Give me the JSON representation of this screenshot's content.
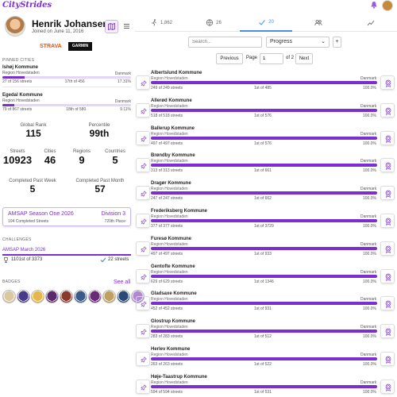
{
  "app": {
    "logo_text": "CityStrides"
  },
  "profile": {
    "name": "Henrik Johansen",
    "joined": "Joined on June 11, 2016",
    "integrations": [
      "STRAVA",
      "GARMIN"
    ]
  },
  "pinned": {
    "title": "PINNED CITIES",
    "cities": [
      {
        "name": "Ishøj Kommune",
        "region": "Region Hovedstaden",
        "country": "Danmark",
        "progress": 17.31,
        "streets": "27 of 156 streets",
        "rank": "17th of 456",
        "percent": "17.31%"
      },
      {
        "name": "Egedal Kommune",
        "region": "Region Hovedstaden",
        "country": "Danmark",
        "progress": 9.11,
        "streets": "79 of 867 streets",
        "rank": "18th of 580",
        "percent": "9.11%"
      }
    ]
  },
  "stats": {
    "global_rank_label": "Global Rank",
    "global_rank": "115",
    "percentile_label": "Percentile",
    "percentile": "99th",
    "streets_label": "Streets",
    "streets": "10923",
    "cities_label": "Cities",
    "cities": "46",
    "regions_label": "Regions",
    "regions": "9",
    "countries_label": "Countries",
    "countries": "5",
    "cpw_label": "Completed Past Week",
    "cpw": "5",
    "cpm_label": "Completed Past Month",
    "cpm": "57"
  },
  "season": {
    "title": "AMSAP Season One 2026",
    "division": "Division 3",
    "completed": "104 Completed Streets",
    "place": "720th Place"
  },
  "challenges": {
    "title": "CHALLENGES",
    "name": "AMSAP March 2026",
    "rank": "1101st of 3373",
    "streets": "22 streets"
  },
  "badges": {
    "title": "BADGES",
    "see_all": "See all",
    "colors": [
      "#d9c8a0",
      "#4a3a8a",
      "#e6b84a",
      "#5a2a6a",
      "#8a3a2a",
      "#3a5a8a",
      "#6a2a7a",
      "#c0a060",
      "#2a4a7a",
      "#b08ad0"
    ]
  },
  "tabs": [
    {
      "icon": "runner-icon",
      "count": "1,862"
    },
    {
      "icon": "globe-icon",
      "count": "26"
    },
    {
      "icon": "check-icon",
      "count": "20"
    },
    {
      "icon": "users-icon",
      "count": ""
    },
    {
      "icon": "chart-icon",
      "count": ""
    }
  ],
  "filters": {
    "search_placeholder": "Search...",
    "sort": "Progress",
    "plus": "+"
  },
  "pagination": {
    "previous": "Previous",
    "page_label": "Page",
    "page": "1",
    "of": "of 2",
    "next": "Next"
  },
  "cities": [
    {
      "name": "Albertslund Kommune",
      "region": "Region Hovedstaden",
      "country": "Danmark",
      "streets": "249 of 249 streets",
      "rank": "1st of 485",
      "percent": "100.0%",
      "progress": 100
    },
    {
      "name": "Allerød Kommune",
      "region": "Region Hovedstaden",
      "country": "Danmark",
      "streets": "518 of 518 streets",
      "rank": "1st of 576",
      "percent": "100.0%",
      "progress": 100
    },
    {
      "name": "Ballerup Kommune",
      "region": "Region Hovedstaden",
      "country": "Danmark",
      "streets": "497 of 497 streets",
      "rank": "1st of 576",
      "percent": "100.0%",
      "progress": 100
    },
    {
      "name": "Brøndby Kommune",
      "region": "Region Hovedstaden",
      "country": "Danmark",
      "streets": "313 of 313 streets",
      "rank": "1st of 661",
      "percent": "100.0%",
      "progress": 100
    },
    {
      "name": "Dragør Kommune",
      "region": "Region Hovedstaden",
      "country": "Danmark",
      "streets": "247 of 247 streets",
      "rank": "1st of 662",
      "percent": "100.0%",
      "progress": 100
    },
    {
      "name": "Frederiksberg Kommune",
      "region": "Region Hovedstaden",
      "country": "Danmark",
      "streets": "377 of 377 streets",
      "rank": "1st of 3729",
      "percent": "100.0%",
      "progress": 100
    },
    {
      "name": "Furesø Kommune",
      "region": "Region Hovedstaden",
      "country": "Danmark",
      "streets": "497 of 497 streets",
      "rank": "1st of 933",
      "percent": "100.0%",
      "progress": 100
    },
    {
      "name": "Gentofte Kommune",
      "region": "Region Hovedstaden",
      "country": "Danmark",
      "streets": "629 of 629 streets",
      "rank": "1st of 1346",
      "percent": "100.0%",
      "progress": 100
    },
    {
      "name": "Gladsaxe Kommune",
      "region": "Region Hovedstaden",
      "country": "Danmark",
      "streets": "452 of 452 streets",
      "rank": "1st of 931",
      "percent": "100.0%",
      "progress": 100
    },
    {
      "name": "Glostrup Kommune",
      "region": "Region Hovedstaden",
      "country": "Danmark",
      "streets": "283 of 283 streets",
      "rank": "1st of 512",
      "percent": "100.0%",
      "progress": 100
    },
    {
      "name": "Herlev Kommune",
      "region": "Region Hovedstaden",
      "country": "Danmark",
      "streets": "263 of 263 streets",
      "rank": "1st of 522",
      "percent": "100.0%",
      "progress": 100
    },
    {
      "name": "Høje-Taastrup Kommune",
      "region": "Region Hovedstaden",
      "country": "Danmark",
      "streets": "594 of 594 streets",
      "rank": "1st of 531",
      "percent": "100.0%",
      "progress": 100
    }
  ]
}
